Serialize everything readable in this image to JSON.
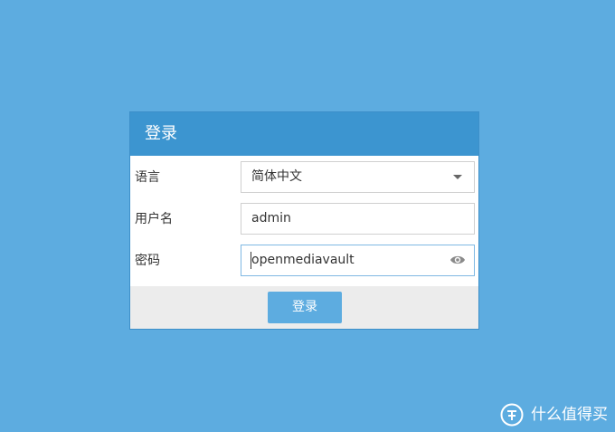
{
  "panel": {
    "title": "登录"
  },
  "form": {
    "language": {
      "label": "语言",
      "value": "简体中文"
    },
    "username": {
      "label": "用户名",
      "value": "admin"
    },
    "password": {
      "label": "密码",
      "value": "openmediavault"
    }
  },
  "footer": {
    "login_label": "登录"
  },
  "watermark": {
    "text": "什么值得买"
  },
  "icons": {
    "dropdown": "chevron-down-icon",
    "password_toggle": "eye-icon",
    "watermark_logo": "smzdm-logo"
  },
  "colors": {
    "background": "#5dace0",
    "header": "#3c95d0",
    "button": "#5dace0",
    "footer": "#ececec"
  }
}
